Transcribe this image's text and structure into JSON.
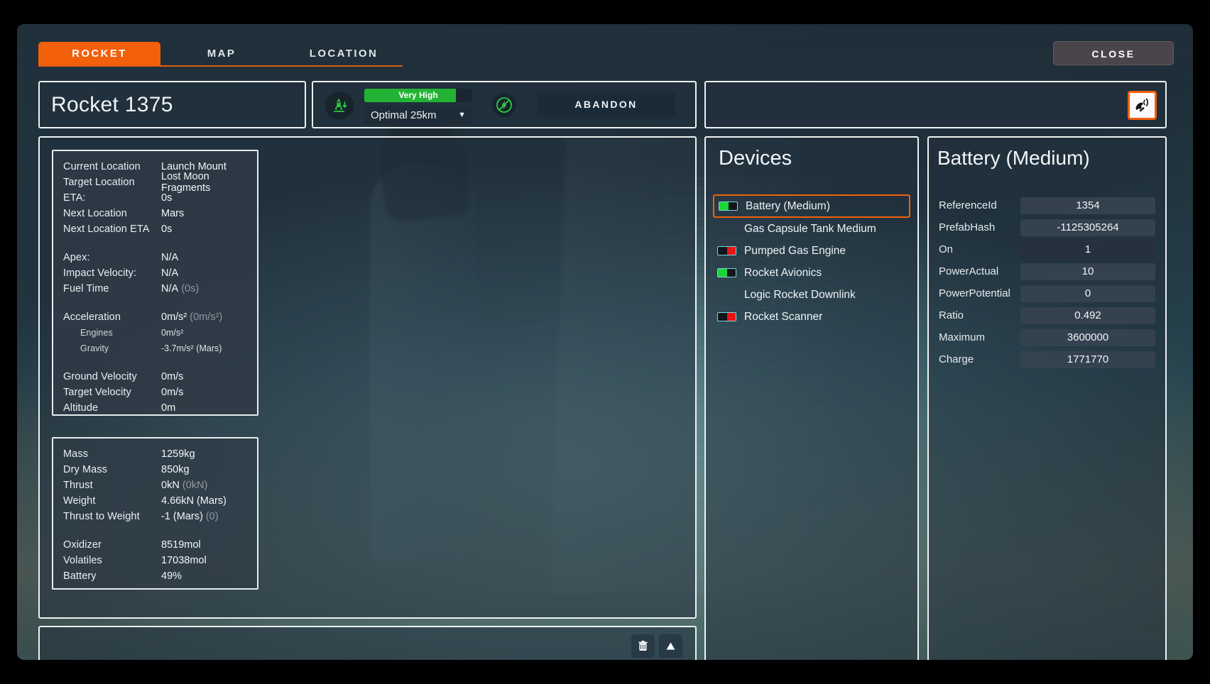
{
  "tabs": [
    {
      "label": "ROCKET",
      "active": true
    },
    {
      "label": "MAP",
      "active": false
    },
    {
      "label": "LOCATION",
      "active": false
    }
  ],
  "close_label": "CLOSE",
  "header": {
    "rocket_title": "Rocket 1375",
    "signal_label": "Very High",
    "signal_percent": 85,
    "altitude_value": "Optimal 25km",
    "caret": "▼",
    "abandon_label": "ABANDON",
    "land_icon": "rocket-landing-icon",
    "power_icon": "power-disabled-icon",
    "satellite_icon": "satellite-dish-icon"
  },
  "stats": {
    "nav": [
      {
        "key": "Current Location",
        "value": "Launch Mount"
      },
      {
        "key": "Target Location",
        "value": "Lost Moon Fragments"
      },
      {
        "key": "ETA:",
        "value": "0s"
      },
      {
        "key": "Next Location",
        "value": "Mars"
      },
      {
        "key": "Next Location ETA",
        "value": "0s"
      }
    ],
    "flight": [
      {
        "key": "Apex:",
        "value": "N/A",
        "dim": ""
      },
      {
        "key": "Impact Velocity:",
        "value": "N/A",
        "dim": ""
      },
      {
        "key": "Fuel Time",
        "value": "N/A",
        "dim": "(0s)"
      }
    ],
    "accel": [
      {
        "key": "Acceleration",
        "value": "0m/s²",
        "dim": "(0m/s²)"
      },
      {
        "key": "Engines",
        "value": "0m/s²",
        "dim": "",
        "sub": true
      },
      {
        "key": "Gravity",
        "value": "-3.7m/s² (Mars)",
        "dim": "",
        "sub": true
      }
    ],
    "velocity": [
      {
        "key": "Ground Velocity",
        "value": "0m/s"
      },
      {
        "key": "Target Velocity",
        "value": "0m/s"
      },
      {
        "key": "Altitude",
        "value": "0m"
      }
    ]
  },
  "mass": {
    "top": [
      {
        "key": "Mass",
        "value": "1259kg",
        "dim": ""
      },
      {
        "key": "Dry Mass",
        "value": "850kg",
        "dim": ""
      },
      {
        "key": "Thrust",
        "value": "0kN",
        "dim": "(0kN)"
      },
      {
        "key": "Weight",
        "value": "4.66kN (Mars)",
        "dim": ""
      },
      {
        "key": "Thrust to Weight",
        "value": "-1 (Mars)",
        "dim": "(0)"
      }
    ],
    "bottom": [
      {
        "key": "Oxidizer",
        "value": "8519mol"
      },
      {
        "key": "Volatiles",
        "value": "17038mol"
      },
      {
        "key": "Battery",
        "value": "49%"
      }
    ]
  },
  "bottom_bar": {
    "trash_icon": "trash-icon",
    "raise_icon": "up-arrow-icon"
  },
  "devices": {
    "title": "Devices",
    "items": [
      {
        "label": "Battery (Medium)",
        "toggle": "on",
        "selected": true,
        "indent": false
      },
      {
        "label": "Gas Capsule Tank Medium",
        "toggle": "none",
        "selected": false,
        "indent": true
      },
      {
        "label": "Pumped Gas Engine",
        "toggle": "off",
        "selected": false,
        "indent": false
      },
      {
        "label": "Rocket Avionics",
        "toggle": "on",
        "selected": false,
        "indent": false
      },
      {
        "label": "Logic Rocket Downlink",
        "toggle": "none",
        "selected": false,
        "indent": true
      },
      {
        "label": "Rocket Scanner",
        "toggle": "off",
        "selected": false,
        "indent": false
      }
    ]
  },
  "properties": {
    "title": "Battery (Medium)",
    "rows": [
      {
        "key": "ReferenceId",
        "value": "1354",
        "dark": false
      },
      {
        "key": "PrefabHash",
        "value": "-1125305264",
        "dark": false
      },
      {
        "key": "On",
        "value": "1",
        "dark": true
      },
      {
        "key": "PowerActual",
        "value": "10",
        "dark": false
      },
      {
        "key": "PowerPotential",
        "value": "0",
        "dark": false
      },
      {
        "key": "Ratio",
        "value": "0.492",
        "dark": false
      },
      {
        "key": "Maximum",
        "value": "3600000",
        "dark": false
      },
      {
        "key": "Charge",
        "value": "1771770",
        "dark": false
      }
    ]
  },
  "colors": {
    "accent": "#f2600c",
    "signal_green": "#23b334",
    "toggle_on": "#17d636",
    "toggle_off": "#e81515",
    "panel_border": "#eef2f3"
  }
}
